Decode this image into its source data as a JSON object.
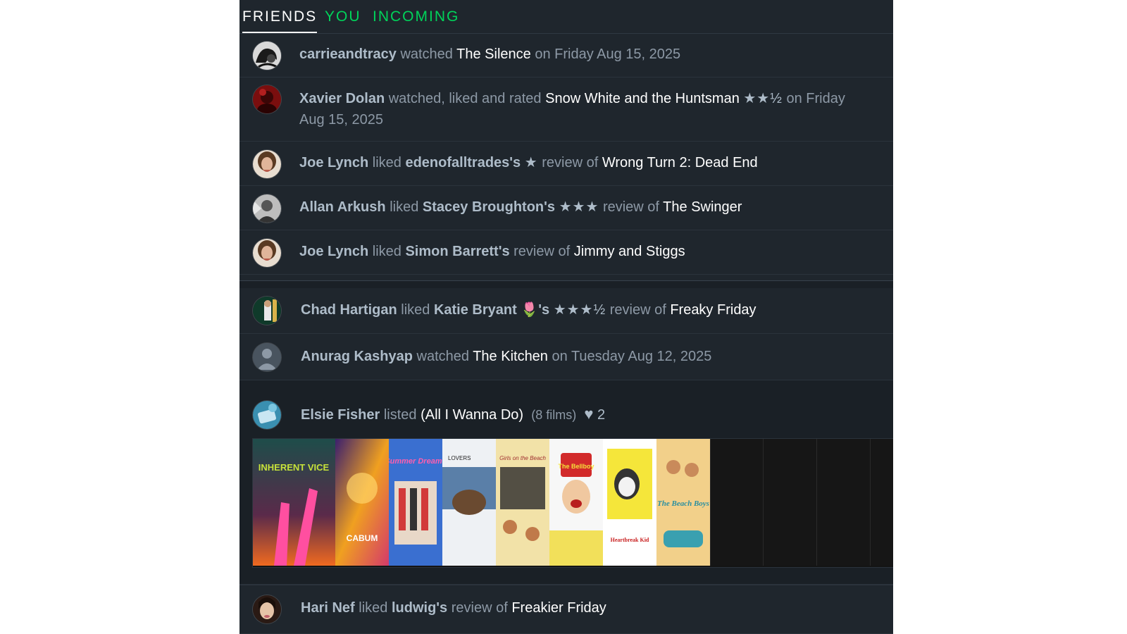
{
  "tabs": {
    "friends": "FRIENDS",
    "you": "YOU",
    "incoming": "INCOMING"
  },
  "activity": [
    {
      "user": "carrieandtracy",
      "verb": "watched",
      "film": "The Silence",
      "tail": "on Friday Aug 15, 2025"
    },
    {
      "user": "Xavier Dolan",
      "verb": "watched, liked and rated",
      "film": "Snow White and the Huntsman",
      "stars": "★★½",
      "tail1": "on Friday",
      "tail2": "Aug 15, 2025"
    },
    {
      "user": "Joe Lynch",
      "verb": "liked",
      "reviewer": "edenofalltrades's",
      "stars": "★",
      "mid": "review of",
      "film": "Wrong Turn 2: Dead End"
    },
    {
      "user": "Allan Arkush",
      "verb": "liked",
      "reviewer": "Stacey Broughton's",
      "stars": "★★★",
      "mid": "review of",
      "film": "The Swinger"
    },
    {
      "user": "Joe Lynch",
      "verb": "liked",
      "reviewer": "Simon Barrett's",
      "mid": "review of",
      "film": "Jimmy and Stiggs"
    },
    {
      "user": "Chad Hartigan",
      "verb": "liked",
      "reviewer": "Katie Bryant",
      "emoji": "🌷",
      "possessive": "'s",
      "stars": "★★★½",
      "mid": "review of",
      "film": "Freaky Friday"
    },
    {
      "user": "Anurag Kashyap",
      "verb": "watched",
      "film": "The Kitchen",
      "tail": "on Tuesday Aug 12, 2025"
    },
    {
      "user": "Elsie Fisher",
      "verb": "listed",
      "list_name": "(All I Wanna Do)",
      "count": "(8 films)",
      "likes": "2"
    },
    {
      "user": "Hari Nef",
      "verb": "liked",
      "reviewer": "ludwig's",
      "mid": "review of",
      "film": "Freakier Friday"
    }
  ],
  "posters": [
    {
      "title": "INHERENT VICE"
    },
    {
      "title": "CABUM"
    },
    {
      "title": "Summer Dreams"
    },
    {
      "title": "LOVERS"
    },
    {
      "title": "Girls on the Beach"
    },
    {
      "title": "The Bellboy"
    },
    {
      "title": "Heartbreak Kid"
    },
    {
      "title": "The Beach Boys"
    }
  ],
  "icons": {
    "like": "heart-icon",
    "default_avatar": "person-silhouette-icon"
  }
}
